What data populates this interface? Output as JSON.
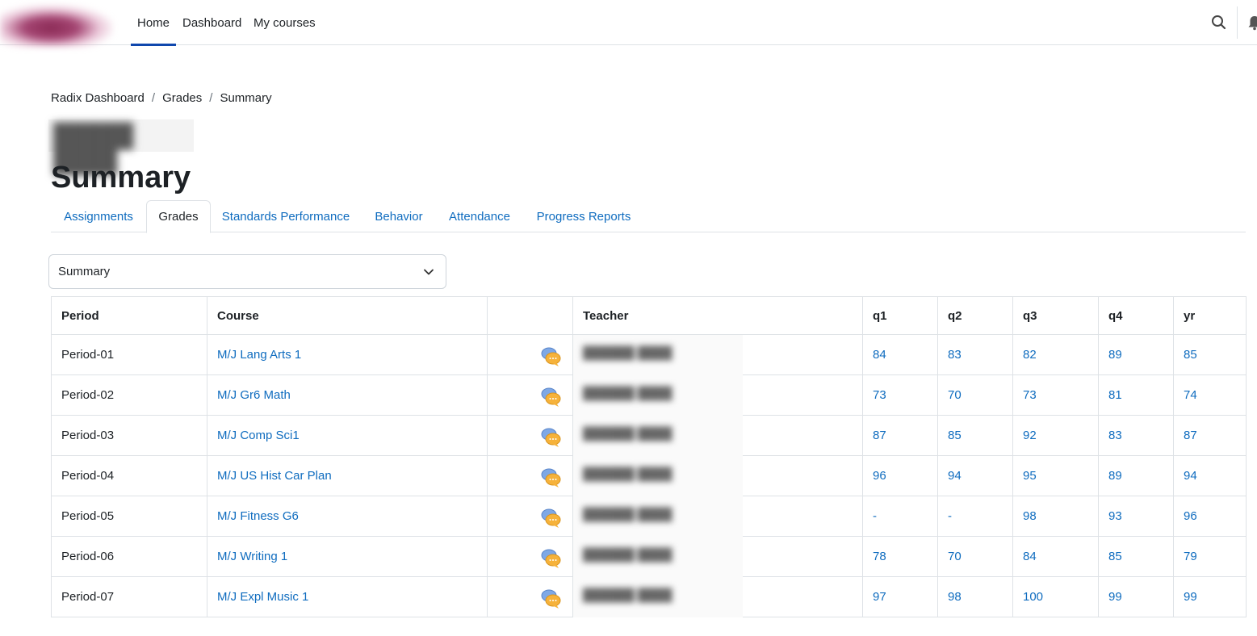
{
  "nav": {
    "items": [
      {
        "label": "Home",
        "active": true
      },
      {
        "label": "Dashboard",
        "active": false
      },
      {
        "label": "My courses",
        "active": false
      }
    ]
  },
  "breadcrumb": [
    {
      "label": "Radix Dashboard"
    },
    {
      "label": "Grades"
    },
    {
      "label": "Summary"
    }
  ],
  "page_title": "Summary",
  "tabs": [
    {
      "label": "Assignments",
      "active": false
    },
    {
      "label": "Grades",
      "active": true
    },
    {
      "label": "Standards Performance",
      "active": false
    },
    {
      "label": "Behavior",
      "active": false
    },
    {
      "label": "Attendance",
      "active": false
    },
    {
      "label": "Progress Reports",
      "active": false
    }
  ],
  "select": {
    "value": "Summary"
  },
  "table": {
    "headers": {
      "period": "Period",
      "course": "Course",
      "comment": "",
      "teacher": "Teacher",
      "q1": "q1",
      "q2": "q2",
      "q3": "q3",
      "q4": "q4",
      "yr": "yr"
    },
    "rows": [
      {
        "period": "Period-01",
        "course": "M/J Lang Arts 1",
        "q1": "84",
        "q2": "83",
        "q3": "82",
        "q4": "89",
        "yr": "85"
      },
      {
        "period": "Period-02",
        "course": "M/J Gr6 Math",
        "q1": "73",
        "q2": "70",
        "q3": "73",
        "q4": "81",
        "yr": "74"
      },
      {
        "period": "Period-03",
        "course": "M/J Comp Sci1",
        "q1": "87",
        "q2": "85",
        "q3": "92",
        "q4": "83",
        "yr": "87"
      },
      {
        "period": "Period-04",
        "course": "M/J US Hist Car Plan",
        "q1": "96",
        "q2": "94",
        "q3": "95",
        "q4": "89",
        "yr": "94"
      },
      {
        "period": "Period-05",
        "course": "M/J Fitness G6",
        "q1": "-",
        "q2": "-",
        "q3": "98",
        "q4": "93",
        "yr": "96"
      },
      {
        "period": "Period-06",
        "course": "M/J Writing 1",
        "q1": "78",
        "q2": "70",
        "q3": "84",
        "q4": "85",
        "yr": "79"
      },
      {
        "period": "Period-07",
        "course": "M/J Expl Music 1",
        "q1": "97",
        "q2": "98",
        "q3": "100",
        "q4": "99",
        "yr": "99"
      }
    ]
  },
  "icons": {
    "search": "search-icon",
    "notifications": "bell-icon",
    "select_chevron": "chevron-down-icon",
    "comment": "chat-bubble-icon"
  },
  "colors": {
    "link": "#0f6cbf",
    "nav_active_underline": "#0f47ad",
    "border": "#dee2e6",
    "text": "#1d2125"
  }
}
